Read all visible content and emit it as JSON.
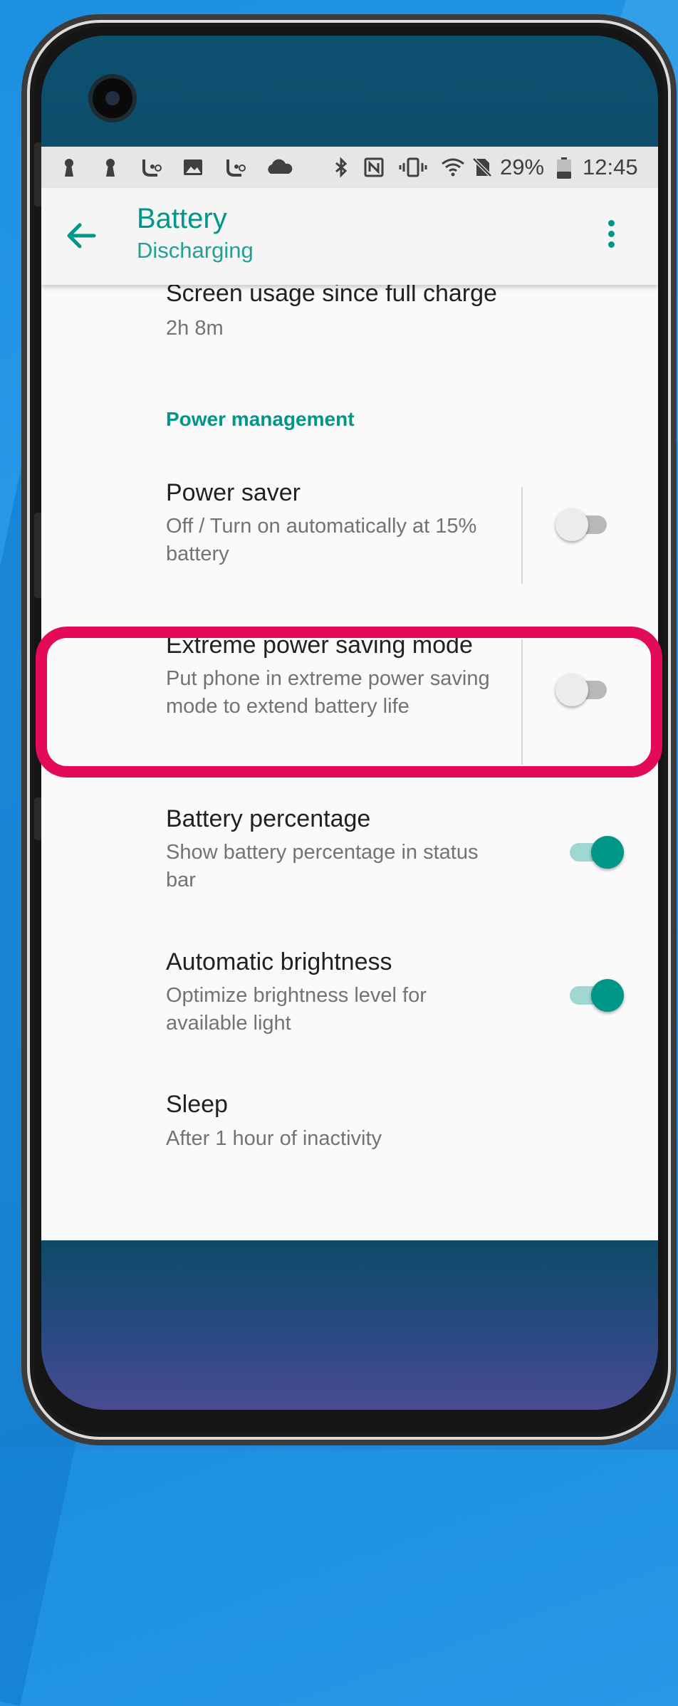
{
  "status_bar": {
    "battery_percent": "29%",
    "time": "12:45",
    "icons": [
      "notification-icon",
      "notification-icon",
      "touchpal-icon",
      "image-icon",
      "touchpal-icon",
      "cloud-icon",
      "bluetooth-icon",
      "nfc-icon",
      "vibrate-icon",
      "wifi-icon",
      "no-sim-icon",
      "battery-icon"
    ]
  },
  "app_bar": {
    "title": "Battery",
    "subtitle": "Discharging"
  },
  "screen_usage": {
    "title": "Screen usage since full charge",
    "value": "2h 8m"
  },
  "section": {
    "title": "Power management"
  },
  "settings": [
    {
      "title": "Power saver",
      "subtitle": "Off / Turn on automatically at 15% battery",
      "toggle": "off"
    },
    {
      "title": "Extreme power saving mode",
      "subtitle": "Put phone in extreme power saving mode to extend battery life",
      "toggle": "off"
    },
    {
      "title": "Battery percentage",
      "subtitle": "Show battery percentage in status bar",
      "toggle": "on"
    },
    {
      "title": "Automatic brightness",
      "subtitle": "Optimize brightness level for available light",
      "toggle": "on"
    },
    {
      "title": "Sleep",
      "subtitle": "After 1 hour of inactivity"
    }
  ],
  "colors": {
    "accent": "#009688",
    "highlight": "#e30a57"
  }
}
